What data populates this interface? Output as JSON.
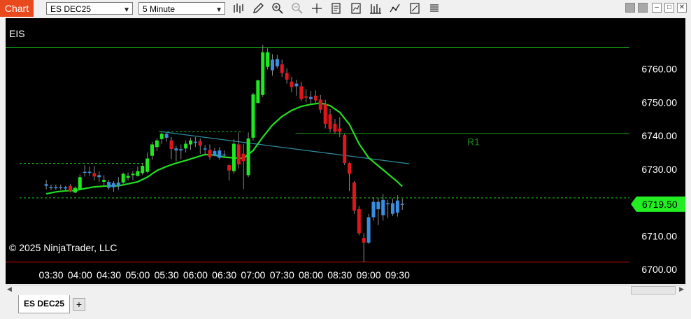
{
  "window": {
    "tab_label": "Chart",
    "instrument": "ES DEC25",
    "interval": "5 Minute",
    "toolbar_icons": [
      "bar-type-icon",
      "draw-pencil-icon",
      "zoom-in-icon",
      "zoom-out-icon",
      "crosshair-icon",
      "data-box-icon",
      "indicators-icon",
      "strategies-icon",
      "chart-style-icon",
      "properties-icon",
      "more-icon"
    ],
    "instrument_tab": "ES DEC25",
    "add_tab": "+"
  },
  "chart_data": {
    "type": "candlestick",
    "title": "EIS",
    "copyright": "© 2025 NinjaTrader, LLC",
    "x_ticks": [
      "03:30",
      "04:00",
      "04:30",
      "05:00",
      "05:30",
      "06:00",
      "06:30",
      "07:00",
      "07:30",
      "08:00",
      "08:30",
      "09:00",
      "09:30"
    ],
    "y_ticks": [
      "6760.00",
      "6750.00",
      "6740.00",
      "6730.00",
      "6720.00",
      "6710.00",
      "6700.00"
    ],
    "ylim": [
      6697.7,
      6775.2
    ],
    "last_price": "6719.50",
    "colors": {
      "up": "#1ee81e",
      "down": "#e0161b",
      "doji_up": "#3a8ee0",
      "ma": "#22dd22",
      "trend": "#2f8f9f",
      "level_green": "#1ec81e",
      "level_red": "#d01010",
      "r1": "#1b8a1b"
    },
    "r1_label": "R1",
    "lines": {
      "eis_level": 6766.5,
      "red_level": 6702.2,
      "r1_level": 6740.7,
      "dash_upper_left": 6731.7,
      "dash_upper_mid": 6741.2,
      "dash_lower": 6721.4
    },
    "trendline": {
      "start_x": "05:25",
      "start_y": 6741.2,
      "end_x": "09:35",
      "end_y": 6731.6
    },
    "candles": [
      {
        "t": "03:25",
        "o": 6725.5,
        "h": 6726.8,
        "l": 6724.0,
        "c": 6725.0,
        "k": "n"
      },
      {
        "t": "03:30",
        "o": 6724.6,
        "h": 6725.4,
        "l": 6723.8,
        "c": 6724.4,
        "k": "n"
      },
      {
        "t": "03:35",
        "o": 6724.6,
        "h": 6725.4,
        "l": 6723.8,
        "c": 6724.6,
        "k": "n"
      },
      {
        "t": "03:40",
        "o": 6724.6,
        "h": 6725.4,
        "l": 6723.8,
        "c": 6724.4,
        "k": "n"
      },
      {
        "t": "03:45",
        "o": 6724.2,
        "h": 6725.0,
        "l": 6723.4,
        "c": 6724.6,
        "k": "n"
      },
      {
        "t": "03:50",
        "o": 6725.0,
        "h": 6725.6,
        "l": 6723.0,
        "c": 6723.4,
        "k": "d"
      },
      {
        "t": "03:55",
        "o": 6723.0,
        "h": 6724.8,
        "l": 6722.8,
        "c": 6724.4,
        "k": "u"
      },
      {
        "t": "04:00",
        "o": 6724.0,
        "h": 6728.4,
        "l": 6724.0,
        "c": 6727.6,
        "k": "u"
      },
      {
        "t": "04:05",
        "o": 6729.2,
        "h": 6731.2,
        "l": 6727.8,
        "c": 6729.0,
        "k": "n"
      },
      {
        "t": "04:10",
        "o": 6729.2,
        "h": 6730.8,
        "l": 6728.0,
        "c": 6729.0,
        "k": "n"
      },
      {
        "t": "04:15",
        "o": 6728.8,
        "h": 6731.0,
        "l": 6726.6,
        "c": 6727.8,
        "k": "d"
      },
      {
        "t": "04:20",
        "o": 6727.6,
        "h": 6729.4,
        "l": 6726.2,
        "c": 6728.2,
        "k": "n"
      },
      {
        "t": "04:25",
        "o": 6726.8,
        "h": 6728.2,
        "l": 6725.0,
        "c": 6726.2,
        "k": "u"
      },
      {
        "t": "04:30",
        "o": 6726.2,
        "h": 6726.8,
        "l": 6723.8,
        "c": 6724.4,
        "k": "n"
      },
      {
        "t": "04:35",
        "o": 6724.6,
        "h": 6726.4,
        "l": 6723.2,
        "c": 6725.8,
        "k": "n"
      },
      {
        "t": "04:40",
        "o": 6726.0,
        "h": 6727.6,
        "l": 6723.8,
        "c": 6725.0,
        "k": "n"
      },
      {
        "t": "04:45",
        "o": 6726.0,
        "h": 6729.0,
        "l": 6725.6,
        "c": 6728.6,
        "k": "u"
      },
      {
        "t": "04:50",
        "o": 6727.4,
        "h": 6729.0,
        "l": 6726.6,
        "c": 6728.0,
        "k": "u"
      },
      {
        "t": "04:55",
        "o": 6728.2,
        "h": 6729.4,
        "l": 6726.8,
        "c": 6728.6,
        "k": "u"
      },
      {
        "t": "05:00",
        "o": 6728.0,
        "h": 6730.8,
        "l": 6727.8,
        "c": 6729.4,
        "k": "u"
      },
      {
        "t": "05:05",
        "o": 6728.8,
        "h": 6731.8,
        "l": 6728.2,
        "c": 6731.0,
        "k": "u"
      },
      {
        "t": "05:10",
        "o": 6729.2,
        "h": 6735.0,
        "l": 6728.8,
        "c": 6733.2,
        "k": "u"
      },
      {
        "t": "05:15",
        "o": 6734.0,
        "h": 6738.2,
        "l": 6732.8,
        "c": 6737.4,
        "k": "u"
      },
      {
        "t": "05:20",
        "o": 6736.6,
        "h": 6739.2,
        "l": 6735.4,
        "c": 6738.6,
        "k": "u"
      },
      {
        "t": "05:25",
        "o": 6739.0,
        "h": 6741.4,
        "l": 6737.6,
        "c": 6740.6,
        "k": "u"
      },
      {
        "t": "05:30",
        "o": 6740.6,
        "h": 6741.0,
        "l": 6738.2,
        "c": 6739.4,
        "k": "n"
      },
      {
        "t": "05:35",
        "o": 6738.6,
        "h": 6739.6,
        "l": 6733.0,
        "c": 6736.0,
        "k": "d"
      },
      {
        "t": "05:40",
        "o": 6735.6,
        "h": 6737.0,
        "l": 6732.4,
        "c": 6736.2,
        "k": "n"
      },
      {
        "t": "05:45",
        "o": 6735.6,
        "h": 6737.4,
        "l": 6733.0,
        "c": 6736.0,
        "k": "n"
      },
      {
        "t": "05:50",
        "o": 6736.2,
        "h": 6738.6,
        "l": 6735.0,
        "c": 6737.6,
        "k": "u"
      },
      {
        "t": "05:55",
        "o": 6737.4,
        "h": 6739.4,
        "l": 6735.8,
        "c": 6738.6,
        "k": "u"
      },
      {
        "t": "06:00",
        "o": 6738.0,
        "h": 6739.6,
        "l": 6736.6,
        "c": 6738.2,
        "k": "n"
      },
      {
        "t": "06:05",
        "o": 6738.4,
        "h": 6739.2,
        "l": 6734.6,
        "c": 6737.0,
        "k": "d"
      },
      {
        "t": "06:10",
        "o": 6736.2,
        "h": 6737.2,
        "l": 6734.0,
        "c": 6736.0,
        "k": "n"
      },
      {
        "t": "06:15",
        "o": 6735.8,
        "h": 6737.4,
        "l": 6732.8,
        "c": 6733.6,
        "k": "d"
      },
      {
        "t": "06:20",
        "o": 6734.0,
        "h": 6736.4,
        "l": 6733.8,
        "c": 6735.4,
        "k": "n"
      },
      {
        "t": "06:25",
        "o": 6735.6,
        "h": 6736.6,
        "l": 6732.8,
        "c": 6733.4,
        "k": "n"
      },
      {
        "t": "06:30",
        "o": 6734.4,
        "h": 6735.6,
        "l": 6733.6,
        "c": 6734.4,
        "k": "n"
      },
      {
        "t": "06:35",
        "o": 6731.2,
        "h": 6731.4,
        "l": 6726.6,
        "c": 6729.6,
        "k": "d"
      },
      {
        "t": "06:40",
        "o": 6729.4,
        "h": 6739.0,
        "l": 6728.6,
        "c": 6737.6,
        "k": "u"
      },
      {
        "t": "06:45",
        "o": 6737.4,
        "h": 6741.0,
        "l": 6730.2,
        "c": 6731.4,
        "k": "d"
      },
      {
        "t": "06:50",
        "o": 6732.4,
        "h": 6737.6,
        "l": 6724.0,
        "c": 6734.6,
        "k": "d"
      },
      {
        "t": "06:55",
        "o": 6728.2,
        "h": 6741.0,
        "l": 6727.6,
        "c": 6739.2,
        "k": "u"
      },
      {
        "t": "07:00",
        "o": 6739.4,
        "h": 6752.8,
        "l": 6738.6,
        "c": 6752.4,
        "k": "u"
      },
      {
        "t": "07:05",
        "o": 6749.8,
        "h": 6756.8,
        "l": 6749.8,
        "c": 6756.6,
        "k": "u"
      },
      {
        "t": "07:10",
        "o": 6752.2,
        "h": 6767.2,
        "l": 6751.6,
        "c": 6765.0,
        "k": "u"
      },
      {
        "t": "07:15",
        "o": 6765.0,
        "h": 6766.2,
        "l": 6759.8,
        "c": 6760.6,
        "k": "u"
      },
      {
        "t": "07:20",
        "o": 6759.6,
        "h": 6764.4,
        "l": 6758.0,
        "c": 6762.8,
        "k": "n"
      },
      {
        "t": "07:25",
        "o": 6763.0,
        "h": 6764.2,
        "l": 6760.2,
        "c": 6760.8,
        "k": "n"
      },
      {
        "t": "07:30",
        "o": 6761.4,
        "h": 6762.8,
        "l": 6757.6,
        "c": 6758.8,
        "k": "d"
      },
      {
        "t": "07:35",
        "o": 6758.8,
        "h": 6760.2,
        "l": 6755.6,
        "c": 6756.8,
        "k": "d"
      },
      {
        "t": "07:40",
        "o": 6756.2,
        "h": 6757.6,
        "l": 6753.0,
        "c": 6754.6,
        "k": "d"
      },
      {
        "t": "07:45",
        "o": 6754.8,
        "h": 6756.8,
        "l": 6752.0,
        "c": 6755.6,
        "k": "n"
      },
      {
        "t": "07:50",
        "o": 6754.8,
        "h": 6756.2,
        "l": 6750.4,
        "c": 6751.0,
        "k": "d"
      },
      {
        "t": "07:55",
        "o": 6751.8,
        "h": 6754.0,
        "l": 6750.0,
        "c": 6751.4,
        "k": "d"
      },
      {
        "t": "08:00",
        "o": 6751.0,
        "h": 6753.4,
        "l": 6749.6,
        "c": 6751.6,
        "k": "n"
      },
      {
        "t": "08:05",
        "o": 6752.0,
        "h": 6753.6,
        "l": 6749.4,
        "c": 6750.6,
        "k": "d"
      },
      {
        "t": "08:10",
        "o": 6750.8,
        "h": 6752.2,
        "l": 6746.8,
        "c": 6747.8,
        "k": "d"
      },
      {
        "t": "08:15",
        "o": 6749.4,
        "h": 6750.8,
        "l": 6742.2,
        "c": 6743.6,
        "k": "d"
      },
      {
        "t": "08:20",
        "o": 6746.4,
        "h": 6748.0,
        "l": 6741.0,
        "c": 6742.0,
        "k": "d"
      },
      {
        "t": "08:25",
        "o": 6743.6,
        "h": 6745.0,
        "l": 6740.6,
        "c": 6741.2,
        "k": "d"
      },
      {
        "t": "08:30",
        "o": 6742.2,
        "h": 6745.6,
        "l": 6739.6,
        "c": 6741.2,
        "k": "d"
      },
      {
        "t": "08:35",
        "o": 6740.2,
        "h": 6740.6,
        "l": 6731.2,
        "c": 6731.8,
        "k": "d"
      },
      {
        "t": "08:40",
        "o": 6731.8,
        "h": 6732.0,
        "l": 6723.4,
        "c": 6728.6,
        "k": "d"
      },
      {
        "t": "08:45",
        "o": 6726.0,
        "h": 6726.4,
        "l": 6716.6,
        "c": 6717.6,
        "k": "d"
      },
      {
        "t": "08:50",
        "o": 6718.0,
        "h": 6719.0,
        "l": 6710.2,
        "c": 6710.8,
        "k": "d"
      },
      {
        "t": "08:55",
        "o": 6709.4,
        "h": 6710.8,
        "l": 6702.2,
        "c": 6708.0,
        "k": "d"
      },
      {
        "t": "09:00",
        "o": 6708.0,
        "h": 6716.6,
        "l": 6707.6,
        "c": 6715.6,
        "k": "n"
      },
      {
        "t": "09:05",
        "o": 6715.6,
        "h": 6721.6,
        "l": 6714.6,
        "c": 6720.2,
        "k": "n"
      },
      {
        "t": "09:10",
        "o": 6720.2,
        "h": 6721.4,
        "l": 6713.2,
        "c": 6718.0,
        "k": "n"
      },
      {
        "t": "09:15",
        "o": 6716.2,
        "h": 6722.6,
        "l": 6714.6,
        "c": 6720.8,
        "k": "n"
      },
      {
        "t": "09:20",
        "o": 6719.6,
        "h": 6720.8,
        "l": 6715.4,
        "c": 6719.8,
        "k": "n"
      },
      {
        "t": "09:25",
        "o": 6719.8,
        "h": 6721.2,
        "l": 6716.0,
        "c": 6716.6,
        "k": "n"
      },
      {
        "t": "09:30",
        "o": 6717.0,
        "h": 6722.2,
        "l": 6715.8,
        "c": 6720.6,
        "k": "n"
      },
      {
        "t": "09:35",
        "o": 6719.6,
        "h": 6721.2,
        "l": 6717.8,
        "c": 6719.5,
        "k": "n"
      }
    ],
    "ma": [
      [
        "03:25",
        6722.6
      ],
      [
        "03:35",
        6723.2
      ],
      [
        "03:45",
        6723.5
      ],
      [
        "03:55",
        6723.6
      ],
      [
        "04:05",
        6724.2
      ],
      [
        "04:15",
        6724.7
      ],
      [
        "04:30",
        6725.0
      ],
      [
        "04:40",
        6725.0
      ],
      [
        "04:50",
        6725.6
      ],
      [
        "05:00",
        6726.2
      ],
      [
        "05:10",
        6727.6
      ],
      [
        "05:20",
        6729.6
      ],
      [
        "05:30",
        6730.8
      ],
      [
        "05:40",
        6731.8
      ],
      [
        "05:50",
        6732.6
      ],
      [
        "06:00",
        6733.5
      ],
      [
        "06:10",
        6734.4
      ],
      [
        "06:20",
        6734.2
      ],
      [
        "06:30",
        6733.6
      ],
      [
        "06:40",
        6733.4
      ],
      [
        "06:50",
        6733.2
      ],
      [
        "07:00",
        6735.6
      ],
      [
        "07:10",
        6739.6
      ],
      [
        "07:20",
        6743.2
      ],
      [
        "07:30",
        6745.8
      ],
      [
        "07:40",
        6747.6
      ],
      [
        "07:50",
        6748.8
      ],
      [
        "08:00",
        6749.4
      ],
      [
        "08:10",
        6749.8
      ],
      [
        "08:20",
        6749.0
      ],
      [
        "08:30",
        6747.0
      ],
      [
        "08:40",
        6743.4
      ],
      [
        "08:50",
        6737.6
      ],
      [
        "09:00",
        6733.4
      ],
      [
        "09:10",
        6731.0
      ],
      [
        "09:20",
        6728.6
      ],
      [
        "09:30",
        6726.2
      ],
      [
        "09:35",
        6724.8
      ]
    ]
  }
}
